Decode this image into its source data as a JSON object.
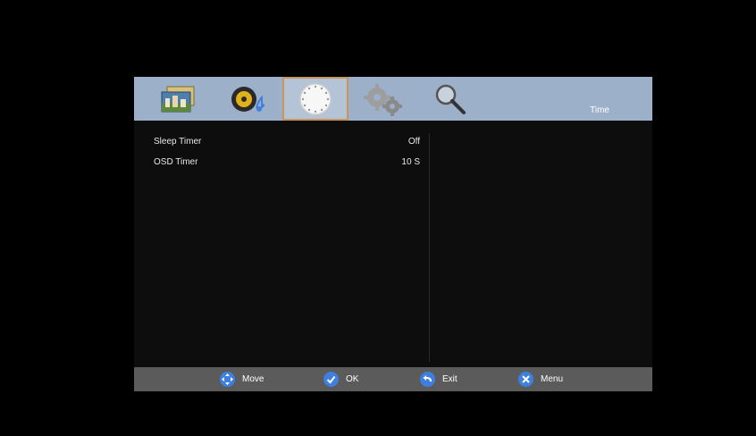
{
  "header": {
    "section_title": "Time",
    "tabs": [
      {
        "icon": "picture-icon"
      },
      {
        "icon": "music-icon"
      },
      {
        "icon": "clock-icon",
        "active": true
      },
      {
        "icon": "settings-gears-icon"
      },
      {
        "icon": "search-icon"
      }
    ]
  },
  "settings": {
    "rows": [
      {
        "label": "Sleep Timer",
        "value": "Off"
      },
      {
        "label": "OSD Timer",
        "value": "10 S"
      }
    ]
  },
  "footer": {
    "move": "Move",
    "ok": "OK",
    "exit": "Exit",
    "menu": "Menu"
  },
  "colors": {
    "header_bg": "#9cb0ca",
    "active_tab_border": "#c8955a",
    "footer_bg": "#5b5b5b",
    "hint_icon": "#3f7fe0"
  }
}
